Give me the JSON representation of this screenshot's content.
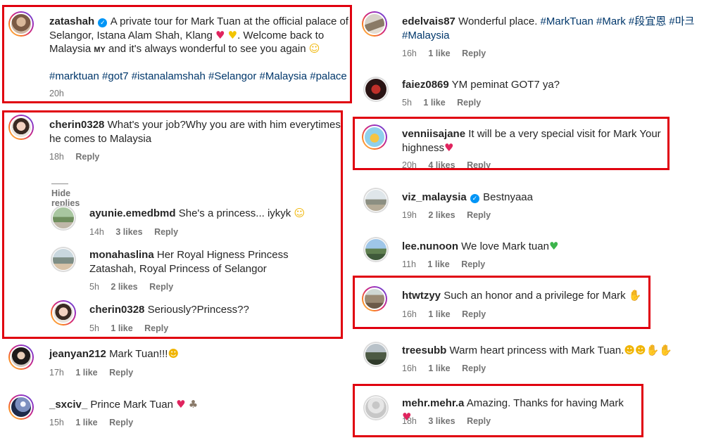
{
  "left_comments": [
    {
      "user": "zatashah",
      "verified": true,
      "text_1": "A private tour for Mark Tuan at the official palace of Selangor, Istana Alam Shah, Klang",
      "text_2": ". Welcome back to Malaysia",
      "text_3": "and it's always wonderful to see you again",
      "flag_text": "MY",
      "hashtags": "#marktuan #got7 #istanalamshah #Selangor #Malaysia #palace",
      "time": "20h"
    },
    {
      "user": "cherin0328",
      "text": "What's your job?Why you are with him everytimes he comes to Malaysia",
      "time": "18h",
      "reply_label": "Reply",
      "hide_replies_label": "Hide replies"
    }
  ],
  "replies": [
    {
      "user": "ayunie.emedbmd",
      "text": "She's a princess... iykyk",
      "time": "14h",
      "likes": "3 likes",
      "reply_label": "Reply"
    },
    {
      "user": "monahaslina",
      "text": "Her Royal Higness Princess Zatashah, Royal Princess of Selangor",
      "time": "5h",
      "likes": "2 likes",
      "reply_label": "Reply"
    },
    {
      "user": "cherin0328",
      "text": "Seriously?Princess??",
      "time": "5h",
      "likes": "1 like",
      "reply_label": "Reply"
    }
  ],
  "left_more": [
    {
      "user": "jeanyan212",
      "text": "Mark Tuan!!!",
      "time": "17h",
      "likes": "1 like",
      "reply_label": "Reply"
    },
    {
      "user": "_sxciv_",
      "text": "Prince Mark Tuan",
      "time": "15h",
      "likes": "1 like",
      "reply_label": "Reply"
    }
  ],
  "right_comments": [
    {
      "user": "edelvais87",
      "text": "Wonderful place.",
      "hashtags": "#MarkTuan #Mark #段宜恩 #마크 #Malaysia",
      "time": "16h",
      "likes": "1 like",
      "reply_label": "Reply"
    },
    {
      "user": "faiez0869",
      "text": "YM peminat GOT7 ya?",
      "time": "5h",
      "likes": "1 like",
      "reply_label": "Reply"
    },
    {
      "user": "venniisajane",
      "text": "It will be a very special visit for Mark Your highness",
      "time": "20h",
      "likes": "4 likes",
      "reply_label": "Reply"
    },
    {
      "user": "viz_malaysia",
      "verified": true,
      "text": "Bestnyaaa",
      "time": "19h",
      "likes": "2 likes",
      "reply_label": "Reply"
    },
    {
      "user": "lee.nunoon",
      "text": "We love Mark tuan",
      "time": "11h",
      "likes": "1 like",
      "reply_label": "Reply"
    },
    {
      "user": "htwtzyy",
      "text": "Such an honor and a privilege for Mark",
      "time": "16h",
      "likes": "1 like",
      "reply_label": "Reply"
    },
    {
      "user": "treesubb",
      "text": "Warm heart princess with Mark Tuan.",
      "time": "16h",
      "likes": "1 like",
      "reply_label": "Reply"
    },
    {
      "user": "mehr.mehr.a",
      "text": "Amazing. Thanks for having Mark",
      "time": "18h",
      "likes": "3 likes",
      "reply_label": "Reply"
    }
  ],
  "emoji": {
    "red_heart": "♥",
    "yellow_heart": "♥",
    "green_heart": "♥",
    "grin": "☺",
    "smile": "☺",
    "heart_eyes": "☻",
    "pray": "✋",
    "rabbit": "♣"
  },
  "colors": {
    "highlight_box": "#e0000f",
    "username": "#262626",
    "hashtag": "#00376b",
    "meta": "#737373",
    "verified": "#0095f6"
  }
}
